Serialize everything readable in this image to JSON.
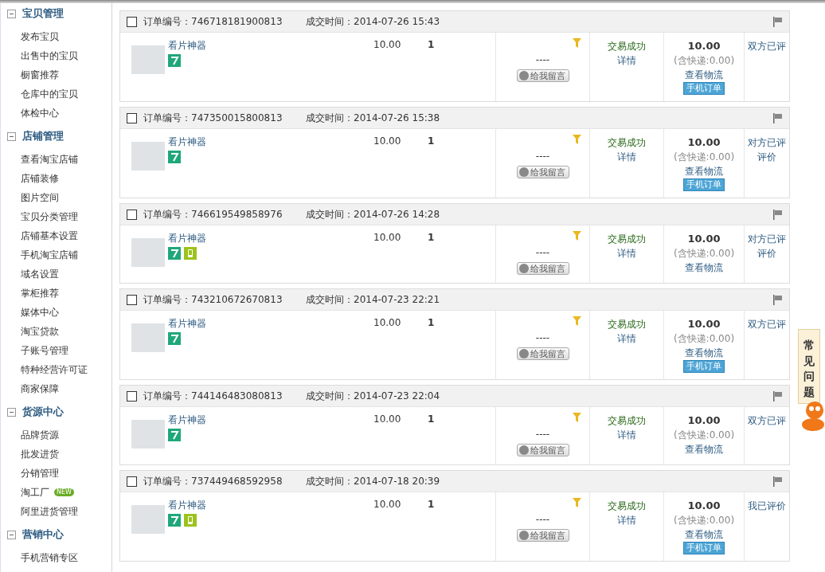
{
  "sidebar": {
    "groups": [
      {
        "title": "宝贝管理",
        "expanded": true,
        "items": [
          {
            "label": "发布宝贝"
          },
          {
            "label": "出售中的宝贝"
          },
          {
            "label": "橱窗推荐"
          },
          {
            "label": "仓库中的宝贝"
          },
          {
            "label": "体检中心"
          }
        ]
      },
      {
        "title": "店铺管理",
        "expanded": true,
        "items": [
          {
            "label": "查看淘宝店铺"
          },
          {
            "label": "店铺装修"
          },
          {
            "label": "图片空间"
          },
          {
            "label": "宝贝分类管理"
          },
          {
            "label": "店铺基本设置"
          },
          {
            "label": "手机淘宝店铺"
          },
          {
            "label": "域名设置"
          },
          {
            "label": "掌柜推荐"
          },
          {
            "label": "媒体中心"
          },
          {
            "label": "淘宝贷款"
          },
          {
            "label": "子账号管理"
          },
          {
            "label": "特种经营许可证"
          },
          {
            "label": "商家保障"
          }
        ]
      },
      {
        "title": "货源中心",
        "expanded": true,
        "items": [
          {
            "label": "品牌货源"
          },
          {
            "label": "批发进货"
          },
          {
            "label": "分销管理"
          },
          {
            "label": "淘工厂",
            "badge": "NEW"
          },
          {
            "label": "阿里进货管理"
          }
        ]
      },
      {
        "title": "营销中心",
        "expanded": true,
        "items": [
          {
            "label": "手机营销专区"
          }
        ]
      }
    ]
  },
  "orders": [
    {
      "checked": false,
      "order_label": "订单编号：746718181900813",
      "time_label": "成交时间：2014-07-26 15:43",
      "product": "看片神器",
      "badges": [
        {
          "kind": "seven-day"
        }
      ],
      "price": "10.00",
      "qty": "1",
      "note": "----",
      "message_button": "给我留言",
      "status": "交易成功",
      "detail": "详情",
      "total": "10.00",
      "shipping": "(含快递:0.00)",
      "logistics": "查看物流",
      "mobile_order": "手机订单",
      "review": [
        "双方已评"
      ]
    },
    {
      "checked": false,
      "order_label": "订单编号：747350015800813",
      "time_label": "成交时间：2014-07-26 15:38",
      "product": "看片神器",
      "badges": [
        {
          "kind": "seven-day"
        }
      ],
      "price": "10.00",
      "qty": "1",
      "note": "----",
      "message_button": "给我留言",
      "status": "交易成功",
      "detail": "详情",
      "total": "10.00",
      "shipping": "(含快递:0.00)",
      "logistics": "查看物流",
      "mobile_order": "手机订单",
      "review": [
        "对方已评",
        "评价"
      ]
    },
    {
      "checked": false,
      "order_label": "订单编号：746619549858976",
      "time_label": "成交时间：2014-07-26 14:28",
      "product": "看片神器",
      "badges": [
        {
          "kind": "seven-day"
        },
        {
          "kind": "mobile"
        }
      ],
      "price": "10.00",
      "qty": "1",
      "note": "----",
      "message_button": "给我留言",
      "status": "交易成功",
      "detail": "详情",
      "total": "10.00",
      "shipping": "(含快递:0.00)",
      "logistics": "查看物流",
      "review": [
        "对方已评",
        "评价"
      ]
    },
    {
      "checked": false,
      "order_label": "订单编号：743210672670813",
      "time_label": "成交时间：2014-07-23 22:21",
      "product": "看片神器",
      "badges": [
        {
          "kind": "seven-day"
        }
      ],
      "price": "10.00",
      "qty": "1",
      "note": "----",
      "message_button": "给我留言",
      "status": "交易成功",
      "detail": "详情",
      "total": "10.00",
      "shipping": "(含快递:0.00)",
      "logistics": "查看物流",
      "mobile_order": "手机订单",
      "review": [
        "双方已评"
      ]
    },
    {
      "checked": false,
      "order_label": "订单编号：744146483080813",
      "time_label": "成交时间：2014-07-23 22:04",
      "product": "看片神器",
      "badges": [
        {
          "kind": "seven-day"
        }
      ],
      "price": "10.00",
      "qty": "1",
      "note": "----",
      "message_button": "给我留言",
      "status": "交易成功",
      "detail": "详情",
      "total": "10.00",
      "shipping": "(含快递:0.00)",
      "logistics": "查看物流",
      "review": [
        "双方已评"
      ]
    },
    {
      "checked": false,
      "order_label": "订单编号：737449468592958",
      "time_label": "成交时间：2014-07-18 20:39",
      "product": "看片神器",
      "badges": [
        {
          "kind": "seven-day"
        },
        {
          "kind": "mobile"
        }
      ],
      "price": "10.00",
      "qty": "1",
      "note": "----",
      "message_button": "给我留言",
      "status": "交易成功",
      "detail": "详情",
      "total": "10.00",
      "shipping": "(含快递:0.00)",
      "logistics": "查看物流",
      "mobile_order": "手机订单",
      "review": [
        "我已评价"
      ]
    }
  ],
  "faq_tab": "常见问题"
}
